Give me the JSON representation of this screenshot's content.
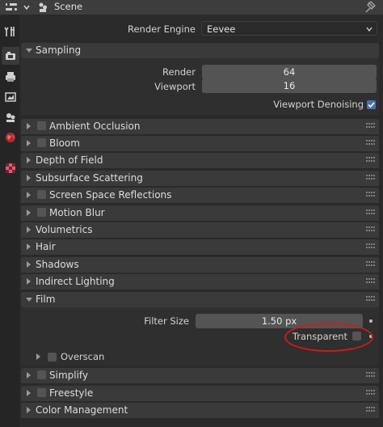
{
  "header": {
    "scene_name": "Scene"
  },
  "render_engine": {
    "label": "Render Engine",
    "value": "Eevee"
  },
  "sampling": {
    "title": "Sampling",
    "render_label": "Render",
    "render_value": "64",
    "viewport_label": "Viewport",
    "viewport_value": "16",
    "denoising_label": "Viewport Denoising"
  },
  "panels": {
    "ambient_occlusion": "Ambient Occlusion",
    "bloom": "Bloom",
    "depth_of_field": "Depth of Field",
    "subsurface_scattering": "Subsurface Scattering",
    "screen_space_reflections": "Screen Space Reflections",
    "motion_blur": "Motion Blur",
    "volumetrics": "Volumetrics",
    "hair": "Hair",
    "shadows": "Shadows",
    "indirect_lighting": "Indirect Lighting",
    "film": "Film",
    "simplify": "Simplify",
    "freestyle": "Freestyle",
    "color_management": "Color Management"
  },
  "film": {
    "filter_size_label": "Filter Size",
    "filter_size_value": "1.50 px",
    "transparent_label": "Transparent",
    "overscan_label": "Overscan"
  },
  "colors": {
    "accent": "#4772b3",
    "highlight": "#cc1c1c"
  }
}
